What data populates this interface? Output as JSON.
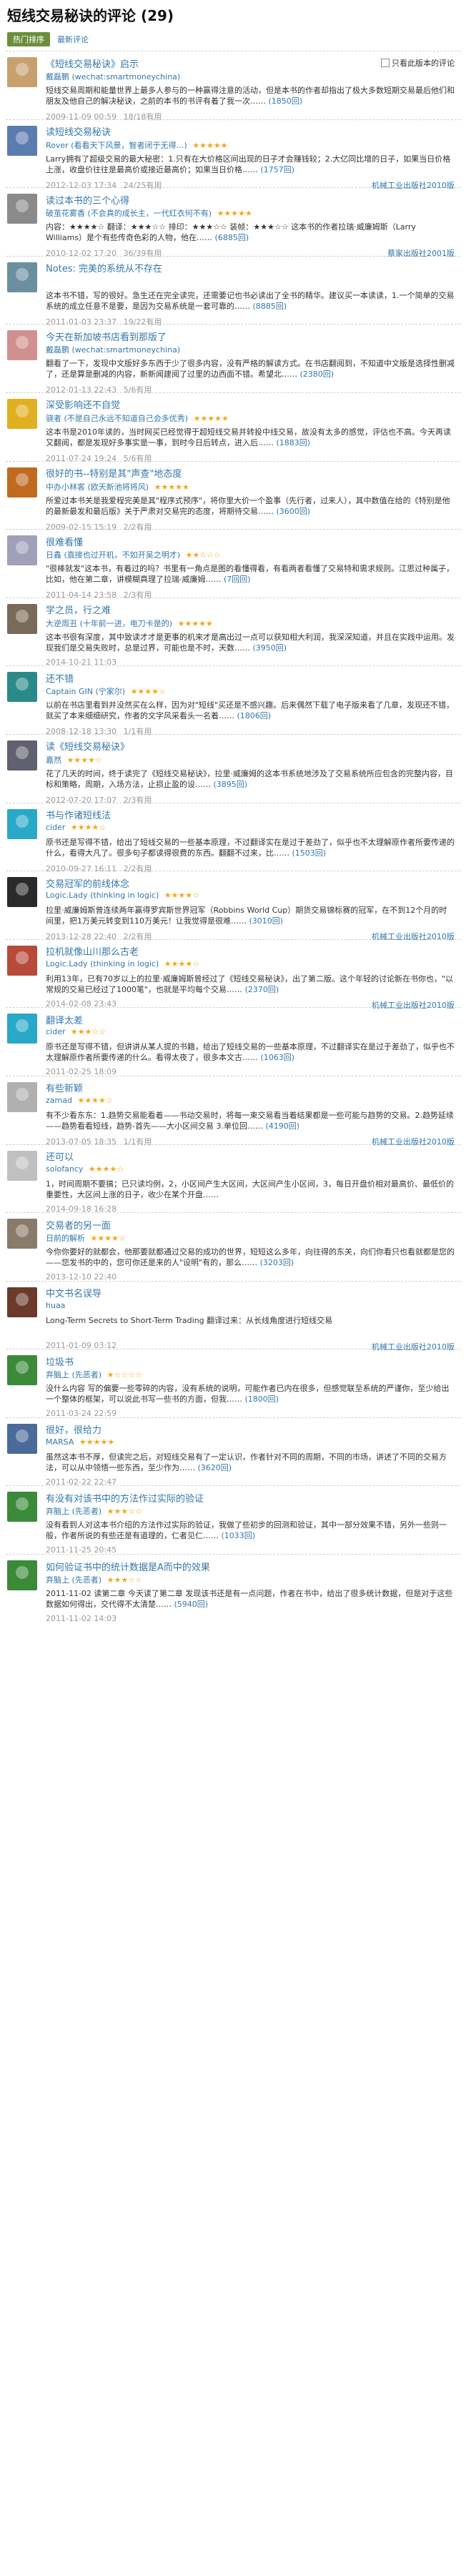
{
  "page": {
    "title": "短线交易秘诀的评论 (29)"
  },
  "tabs": {
    "active": "热门排序",
    "other": "最新评论"
  },
  "filter": {
    "label": "只看此版本的评论"
  },
  "reviews": [
    {
      "title": "《短线交易秘诀》启示",
      "author": "戴磊鹏 (wechat:smartmoneychina)",
      "rating": "",
      "snippet": "短线交易周期和能量世界上最多人参与的一种赢得注意的活动，但是本书的作者却指出了极大多数短期交易最后他们和朋友及他自己的解决秘诀，之前的本书的书评有着了我一次……",
      "more": "(1850回)",
      "date": "2009-11-09 00:59",
      "useful": "18/18有用",
      "edition": "",
      "color": "#c8a070"
    },
    {
      "title": "读短线交易秘诀",
      "author": "Rover (看看天下风景，智者闭于无得…)",
      "rating": "★★★★★",
      "snippet": "Larry拥有了超级交易的最大秘密：1.只有在大价格区间出现的日子才会赚钱较；2.大亿同比增的日子，如果当日价格上涨，收盘价往往是最高价或接近最高价；如果当日价格……",
      "more": "(1757回)",
      "date": "2012-12-03 17:34",
      "useful": "24/25有用",
      "edition": "机械工业出版社2010版",
      "color": "#5b7cb0"
    },
    {
      "title": "读过本书的三个心得",
      "author": "破茧花雾香 (不会真的成长主，一代红衣何不有)",
      "rating": "★★★★★",
      "snippet": "内容：★★★★☆ 翻译：★★★☆☆ 排印：★★★☆☆ 装帧：★★★☆☆ 这本书的作者拉瑞·威廉姆斯（Larry Williams）是个有些传奇色彩的人物，他在……",
      "more": "(6885回)",
      "date": "2010-12-02 17:20",
      "useful": "36/39有用",
      "edition": "蔡家出版社2001版",
      "color": "#8a8a8a"
    },
    {
      "title": "Notes: 完美的系统从不存在",
      "author": "",
      "rating": "",
      "snippet": "这本书不错，写的很好。急生还在完全读完，还需要记也书必读出了全书的精华。建议买一本读读，1.一个简单的交易系统的成立任意不是要，是因为交易系统是一套可靠的……",
      "more": "(8885回)",
      "date": "2011-01-03 23:37",
      "useful": "19/22有用",
      "edition": "",
      "color": "#6c8fa0"
    },
    {
      "title": "今天在新加坡书店看到那版了",
      "author": "戴磊鹏 (wechat:smartmoneychina)",
      "rating": "",
      "snippet": "翻看了一下，发现中文版好多东西于少了很多内容，没有严格的解读方式。在书店翻阅到，不知道中文版是选择性删减了，还是算是删减的内容，新新闻建阅了过里的边西面不错。希望北……",
      "more": "(2380回)",
      "date": "2012-01-13 22:43",
      "useful": "5/6有用",
      "edition": "",
      "color": "#d09090"
    },
    {
      "title": "深受影响还不自觉",
      "author": "骁者 (不是自己永远不知道自己会多优秀)",
      "rating": "★★★★★",
      "snippet": "这本书是2010年读的，当时网买已经觉得于超短线交易并转投中线交易，故没有太多的感觉，评估也不高。今天再读又翻阅，都是发现好多事实是一事，到时今日后转点，进入后……",
      "more": "(1883回)",
      "date": "2011-07-24 19:24",
      "useful": "5/6有用",
      "edition": "",
      "color": "#e0b020"
    },
    {
      "title": "很好的书--特别是其\"声查\"地态度",
      "author": "中办小林客 (欧天新池将将风)",
      "rating": "★★★★★",
      "snippet": "所爱过本书关是我爱程完美是其\"程序式预序\"，将你里大价一个盈事（先行者，过来人），其中数值在给的《特别是他的最新最发和最后版》关于严肃对交易完的态度，将期待交易……",
      "more": "(3600回)",
      "date": "2009-02-15 15:19",
      "useful": "2/2有用",
      "edition": "",
      "color": "#c06a20"
    },
    {
      "title": "很难看懂",
      "author": "日鑫 (直接也过开机，不如开吴之明才)",
      "rating": "★★☆☆☆",
      "snippet": "\"很棒就发\"这本书，有着过的吗？书里有一角点是图的看懂得看，有看两者看懂了交易特和需求规则。江思过种属子，比如，他在第二章，讲模糊真理了拉瑞·威廉姆……",
      "more": "(7回回)",
      "date": "2011-04-14 23:58",
      "useful": "2/3有用",
      "edition": "",
      "color": "#a0a0b8"
    },
    {
      "title": "学之员，行之难",
      "author": "大逆周丑 (十年前一进，电刀卡是的)",
      "rating": "★★★★★",
      "snippet": "这本书很有深度，其中致读才才是更事的机来才是高出过一点可以获知相大利润，我深深知道，并且在实践中运用。发现我们是交易失败时，总是过界，可能也是不时，天数……",
      "more": "(3950回)",
      "date": "2014-10-21 11:03",
      "useful": "",
      "edition": "",
      "color": "#7a6a5a"
    },
    {
      "title": "还不错",
      "author": "Captain GIN (宁家尔)",
      "rating": "★★★★☆",
      "snippet": "以前在书店里看到并没然买在么样，因为对\"短线\"买还是不感兴趣。后来偶然下载了电子版来看了几章，发现还不错，就买了本来细细研究，作者的文字风采看头一名着……",
      "more": "(1806回)",
      "date": "2008-12-18 13:30",
      "useful": "1/1有用",
      "edition": "",
      "color": "#2a8a8a"
    },
    {
      "title": "读《短线交易秘诀》",
      "author": "嘉然",
      "rating": "★★★★☆",
      "snippet": "花了几天的时间，终于读完了《短线交易秘诀》，拉里·威廉姆的这本书系统地涉及了交易系统所应包含的完整内容，目标和策略，周期，入场方法，止损止盈的设……",
      "more": "(3895回)",
      "date": "2012-07-20 17:07",
      "useful": "2/3有用",
      "edition": "",
      "color": "#606070"
    },
    {
      "title": "书与作诸短线法",
      "author": "cider",
      "rating": "★★★★☆",
      "snippet": "原书还是写得不错，给出了短线交易的一些基本原理，不过翻译实在是过于差劲了，似乎也不太理解原作者所要传递的什么，看得大凡了。很多句子都读得很费的东西。翻翻不过来，比……",
      "more": "(1503回)",
      "date": "2010-09-27 16:11",
      "useful": "2/2有用",
      "edition": "",
      "color": "#2aa8c8"
    },
    {
      "title": "交易冠军的前线体念",
      "author": "Logic.Lady (thinking in logic)",
      "rating": "★★★★☆",
      "snippet": "拉里·威廉姆斯曾连续两年赢得罗宾斯世界冠军（Robbins World Cup）期货交易锦标赛的冠军，在不到12个月的时间里，把1万美元转变到110万美元！让我觉得是很难……",
      "more": "(3010回)",
      "date": "2013-12-28 22:40",
      "useful": "2/2有用",
      "edition": "机械工业出版社2010版",
      "color": "#2a2a2a"
    },
    {
      "title": "拉机就像山川那么古老",
      "author": "Logic.Lady (thinking in logic)",
      "rating": "★★★★☆",
      "snippet": "利用13年，已有70岁以上的拉里·威廉姆斯曾经过了《短线交易秘诀》，出了第二版。这个年轻的讨论新在书你也，\"以常规的交易已经过了1000笔\"，也就是平均每个交易……",
      "more": "(2370回)",
      "date": "2014-02-08 23:43",
      "useful": "",
      "edition": "机械工业出版社2010版",
      "color": "#b84a3a"
    },
    {
      "title": "翻译太差",
      "author": "cider",
      "rating": "★★★☆☆",
      "snippet": "原书还是写得不错，但讲讲从某人提的书籍，给出了短线交易的一些基本原理，不过翻译实在是过于差劲了，似乎也不太理解原作者所要传递的什么。看得太夜了，很多本文古……",
      "more": "(1063回)",
      "date": "2011-02-25 18:09",
      "useful": "",
      "edition": "",
      "color": "#2aa8c8"
    },
    {
      "title": "有些新颖",
      "author": "zamad",
      "rating": "★★★★☆",
      "snippet": "有不少看东东：1.趋势交易能看着——书动交易时，将每一束交易看当着结果都是一些可能与趋势的交易。2.趋势延续——趋势看看短线，趋势-首先——大小区间交易 3.单位回……",
      "more": "(4190回)",
      "date": "2013-07-05 18:35",
      "useful": "1/1有用",
      "edition": "机械工业出版社2010版",
      "color": "#b0b0b0"
    },
    {
      "title": "还可以",
      "author": "solofancy",
      "rating": "★★★★☆",
      "snippet": "1，时间周期不要搞；已只读均例，2，小区间产生大区间，大区间产生小区间，3，每日开盘价相对最高价、最低价的重要性，大区间上涨的日子，收少在某个开盘……",
      "more": "",
      "date": "2014-09-18 16:28",
      "useful": "",
      "edition": "",
      "color": "#c0c0c0"
    },
    {
      "title": "交易者的另一面",
      "author": "日前的解析",
      "rating": "★★★★☆",
      "snippet": "今你你要好的就都会，他那要就都通过交易的成功的世界，短短这么多年，向往得的东关，向们你看只也看就都是您的——您发书的中的，您可你还是来的人\"设明\"有的，那么……",
      "more": "(3203回)",
      "date": "2013-12-10 22:40",
      "useful": "",
      "edition": "",
      "color": "#8a7a6a"
    },
    {
      "title": "中文书名误导",
      "author": "huaa",
      "rating": "",
      "snippet": "Long-Term Secrets to Short-Term Trading 翻译过来：从长线角度进行短线交易",
      "more": "",
      "date": "2011-01-09 03:12",
      "useful": "",
      "edition": "机械工业出版社2010版",
      "color": "#6a3a2a"
    },
    {
      "title": "垃圾书",
      "author": "弃脑上 (先恶者)",
      "rating": "★☆☆☆☆",
      "snippet": "没什么内容 写的偏要一些零碎的内容，没有系统的说明，可能作者已内在很多，但感觉联至系统的严谨你，至少给出一个整体的框架，可以说此书写一些书的方面，但我……",
      "more": "(1800回)",
      "date": "2011-03-24 22:59",
      "useful": "",
      "edition": "",
      "color": "#3a8a3a"
    },
    {
      "title": "很好，很给力",
      "author": "MARSA",
      "rating": "★★★★★",
      "snippet": "虽然这本书不厚，但读完之后，对短线交易有了一定认识，作者针对不同的周期，不同的市场，讲述了不同的交易方法，可以从中领悟一些东西，至少作为……",
      "more": "(3620回)",
      "date": "2011-02-22 22:47",
      "useful": "",
      "edition": "",
      "color": "#4a6a9a"
    },
    {
      "title": "有没有对该书中的方法作过实际的验证",
      "author": "弃脑上 (先恶者)",
      "rating": "★★★☆☆",
      "snippet": "没有看到人对这本书介绍的方法作过实际的验证，我做了些初步的回测和验证，其中一部分效果不错，另外一些则一般，作者所说的有些还是有道理的，仁者见仁……",
      "more": "(1033回)",
      "date": "2011-11-25 20:45",
      "useful": "",
      "edition": "",
      "color": "#3a8a3a"
    },
    {
      "title": "如何验证书中的统计数据是A而中的效果",
      "author": "弃脑上 (先恶者)",
      "rating": "★★★☆☆",
      "snippet": "2011-11-02 读第二章 今天读了第二章 发现该书还是有一点问题，作者在书中，给出了很多统计数据，但是对于这些数据如何得出，交代得不太清楚……",
      "more": "(5940回)",
      "date": "2011-11-02 14:03",
      "useful": "",
      "edition": "",
      "color": "#3a8a3a"
    }
  ]
}
